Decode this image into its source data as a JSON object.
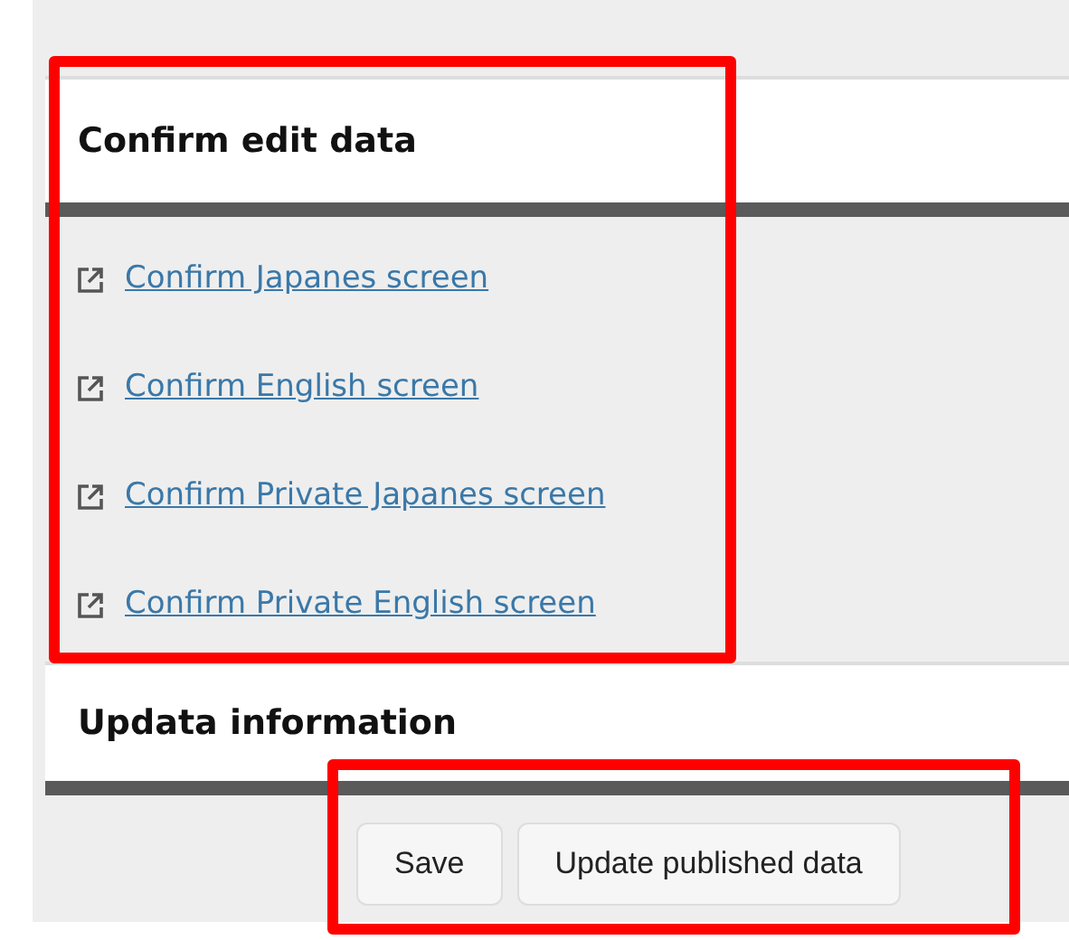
{
  "sections": [
    {
      "title": "Confirm edit data",
      "links": [
        "Confirm Japanes screen",
        "Confirm English screen",
        "Confirm Private Japanes screen",
        "Confirm Private English screen"
      ]
    },
    {
      "title": "Updata information"
    }
  ],
  "buttons": [
    "Save",
    "Update published data"
  ]
}
